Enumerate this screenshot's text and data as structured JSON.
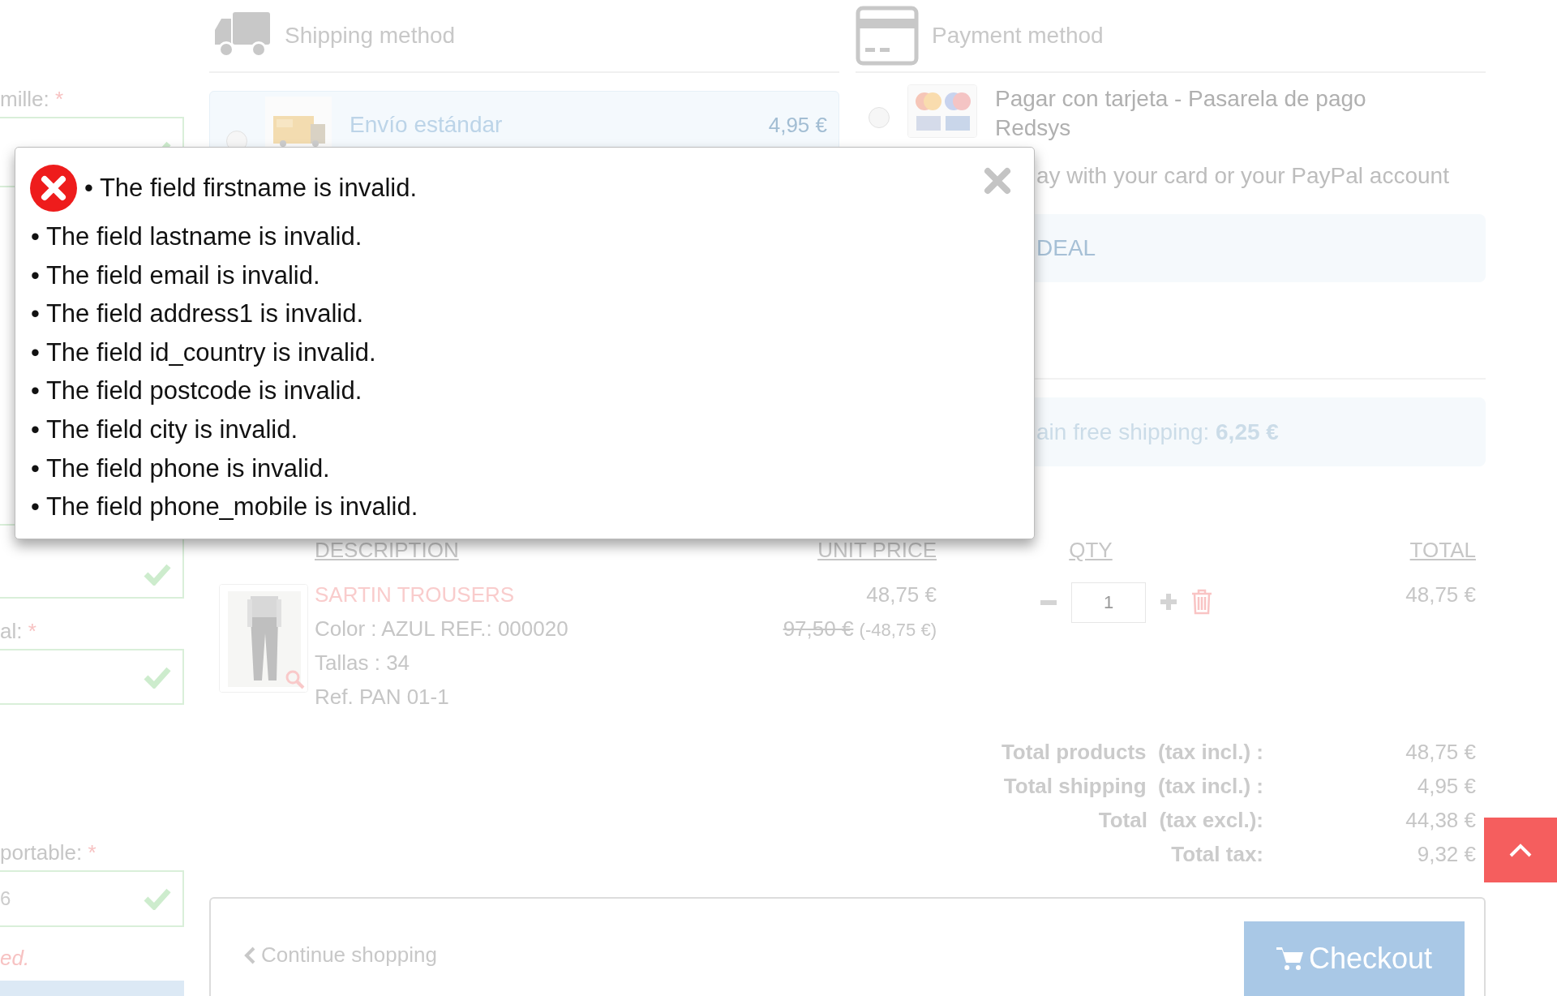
{
  "left_form": [
    {
      "kind": "label",
      "text": "mille:",
      "mark": "*"
    },
    {
      "kind": "field",
      "valid": true
    },
    {
      "kind": "field",
      "valid": true
    },
    {
      "kind": "label",
      "text": "al:",
      "mark": "*"
    },
    {
      "kind": "field",
      "valid": true
    },
    {
      "kind": "label",
      "text": "portable:",
      "mark": "*"
    },
    {
      "kind": "field",
      "value": "6",
      "valid": true
    },
    {
      "kind": "note",
      "text": "ed."
    },
    {
      "kind": "bar"
    }
  ],
  "shipping": {
    "title": "Shipping method",
    "options": [
      {
        "name": "Envío estándar",
        "price": "4,95 €",
        "selected": false
      }
    ]
  },
  "payment": {
    "title": "Payment method",
    "options": [
      {
        "name": "Pagar con tarjeta - Pasarela de pago Redsys",
        "selected": false
      }
    ],
    "description": "ay with your card or your PayPal account",
    "notice": "DEAL"
  },
  "free_shipping": "ain free shipping: **6,25 €**",
  "cart": {
    "columns": [
      "DESCRIPTION",
      "UNIT PRICE",
      "QTY",
      "TOTAL"
    ],
    "items": [
      {
        "name": "SARTIN TROUSERS",
        "details": [
          "Color : AZUL REF.: 000020",
          "Tallas : 34",
          "Ref. PAN 01-1"
        ],
        "price": "48,75 €",
        "old_price": "97,50 €",
        "discount": "(-48,75 €)",
        "qty": "1",
        "total": "48,75 €"
      }
    ]
  },
  "totals": [
    {
      "label": "Total products  (tax incl.) :",
      "value": "48,75 €"
    },
    {
      "label": "Total shipping  (tax incl.) :",
      "value": "4,95 €"
    },
    {
      "label": "Total  (tax excl.):",
      "value": "44,38 €"
    },
    {
      "label": "Total tax:",
      "value": "9,32 €"
    }
  ],
  "footer": {
    "continue": "Continue shopping",
    "checkout": "Checkout"
  },
  "modal": {
    "errors": [
      "• The field firstname is invalid.",
      "• The field lastname is invalid.",
      "• The field email is invalid.",
      "• The field address1 is invalid.",
      "• The field id_country is invalid.",
      "• The field postcode is invalid.",
      "• The field city is invalid.",
      "• The field phone is invalid.",
      "• The field phone_mobile is invalid."
    ]
  }
}
